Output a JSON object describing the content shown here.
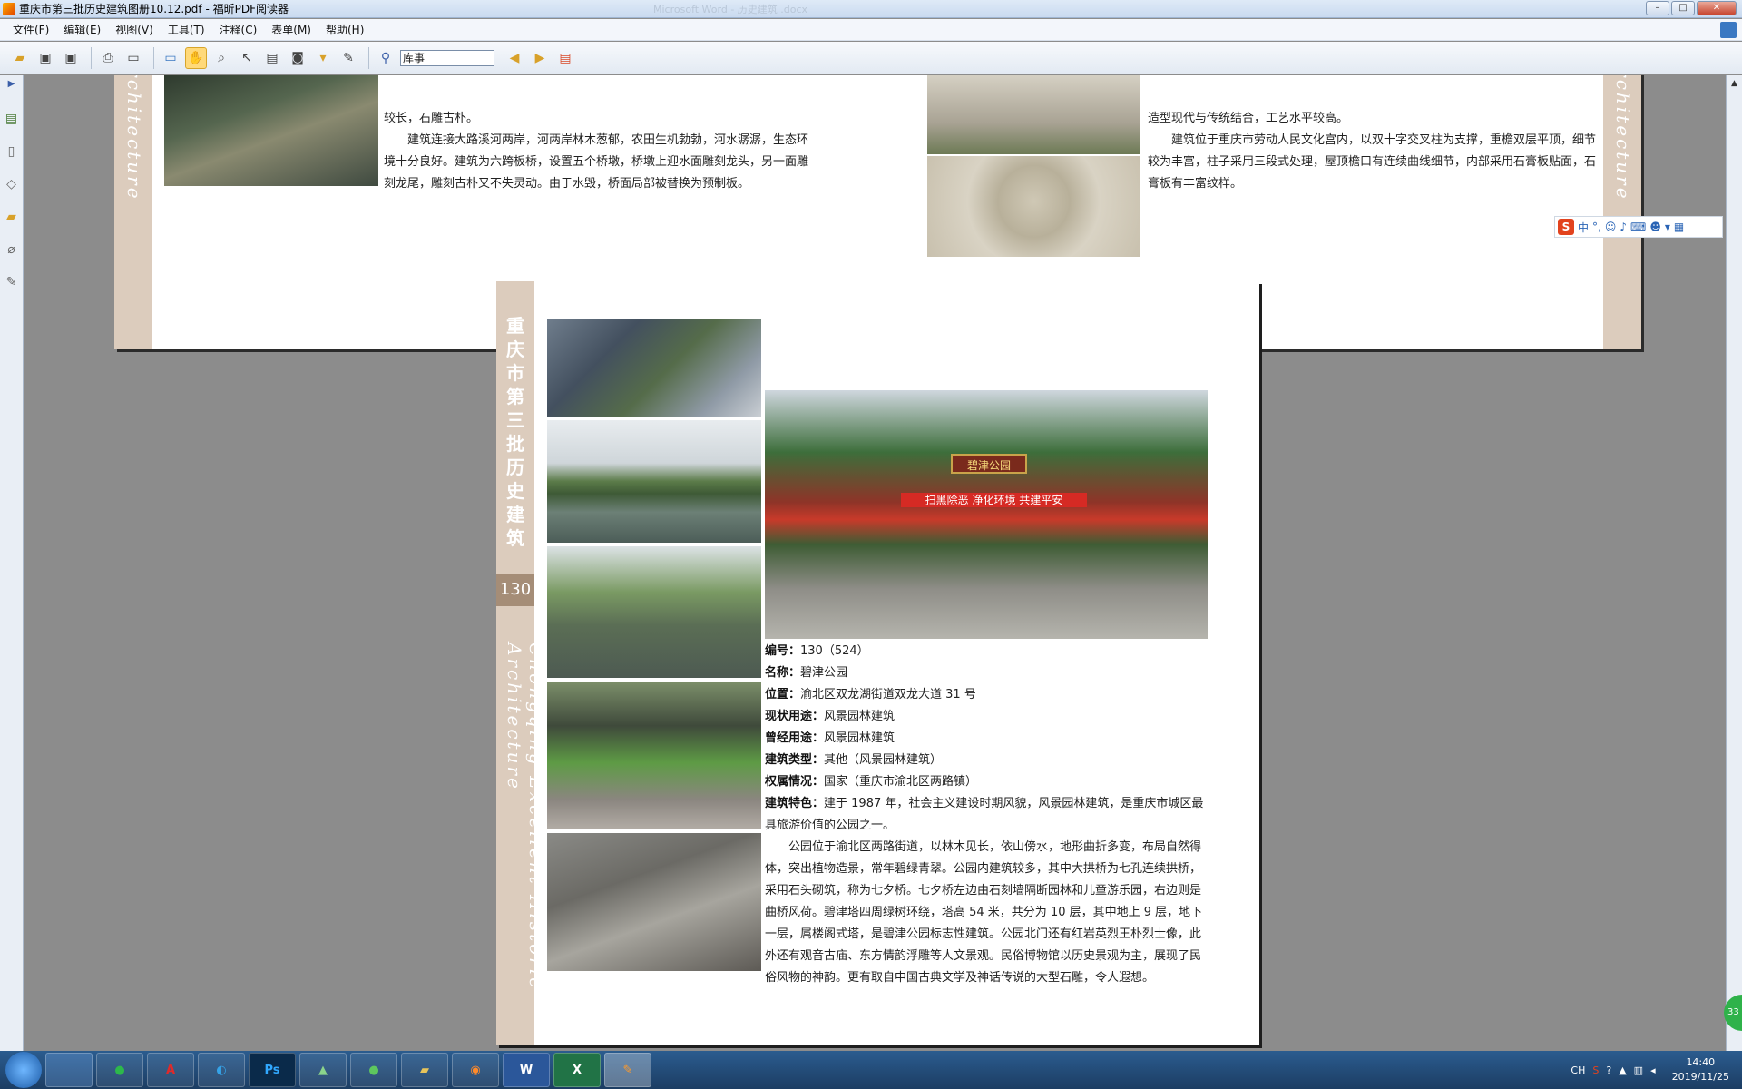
{
  "window": {
    "title": "重庆市第三批历史建筑图册10.12.pdf - 福昕PDF阅读器",
    "ghost_title": "Microsoft Word - 历史建筑 .docx",
    "min": "–",
    "max": "□",
    "close": "✕"
  },
  "menu": [
    "文件(F)",
    "编辑(E)",
    "视图(V)",
    "工具(T)",
    "注释(C)",
    "表单(M)",
    "帮助(H)"
  ],
  "toolbar": {
    "search_value": "库事"
  },
  "page1": {
    "left_para1": "较长，石雕古朴。",
    "left_para2": "建筑连接大路溪河两岸，河两岸林木葱郁，农田生机勃勃，河水潺潺，生态环境十分良好。建筑为六跨板桥，设置五个桥墩，桥墩上迎水面雕刻龙头，另一面雕刻龙尾，雕刻古朴又不失灵动。由于水毁，桥面局部被替换为预制板。",
    "right_para1": "造型现代与传统结合，工艺水平较高。",
    "right_para2": "建筑位于重庆市劳动人民文化宫内，以双十字交叉柱为支撑，重檐双层平顶，细节较为丰富，柱子采用三段式处理，屋顶檐口有连续曲线细节，内部采用石膏板贴面，石膏板有丰富纹样。",
    "band_text": "Historic Architecture"
  },
  "page2": {
    "band_cn": "重庆市第三批历史建筑",
    "page_number": "130",
    "band_en": "Chongqing Excellent Historic Architecture",
    "photo_sign": "碧津公园",
    "photo_banner": "扫黑除恶 净化环境 共建平安",
    "fields": [
      {
        "label": "编号：",
        "value": "130（524）"
      },
      {
        "label": "名称：",
        "value": "碧津公园"
      },
      {
        "label": "位置：",
        "value": "渝北区双龙湖街道双龙大道 31 号"
      },
      {
        "label": "现状用途：",
        "value": "风景园林建筑"
      },
      {
        "label": "曾经用途：",
        "value": "风景园林建筑"
      },
      {
        "label": "建筑类型：",
        "value": "其他（风景园林建筑）"
      },
      {
        "label": "权属情况：",
        "value": "国家（重庆市渝北区两路镇）"
      },
      {
        "label": "建筑特色：",
        "value": "建于 1987 年，社会主义建设时期风貌，风景园林建筑，是重庆市城区最具旅游价值的公园之一。"
      }
    ],
    "paragraph": "公园位于渝北区两路街道，以林木见长，依山傍水，地形曲折多变，布局自然得体，突出植物造景，常年碧绿青翠。公园内建筑较多，其中大拱桥为七孔连续拱桥，采用石头砌筑，称为七夕桥。七夕桥左边由石刻墙隔断园林和儿童游乐园，右边则是曲桥风荷。碧津塔四周绿树环绕，塔高 54 米，共分为 10 层，其中地上 9 层，地下一层，属楼阁式塔，是碧津公园标志性建筑。公园北门还有红岩英烈王朴烈士像，此外还有观音古庙、东方情韵浮雕等人文景观。民俗博物馆以历史景观为主，展现了民俗风物的神韵。更有取自中国古典文学及神话传说的大型石雕，令人遐想。"
  },
  "ime": {
    "logo": "S",
    "mode": "中",
    "punct": "°,"
  },
  "badge": "33",
  "taskbar": {
    "apps": [
      "",
      "",
      "A",
      "",
      "Ps",
      "",
      "",
      "",
      "",
      "W",
      "X",
      ""
    ],
    "lang": "CH",
    "time": "14:40",
    "date": "2019/11/25"
  }
}
